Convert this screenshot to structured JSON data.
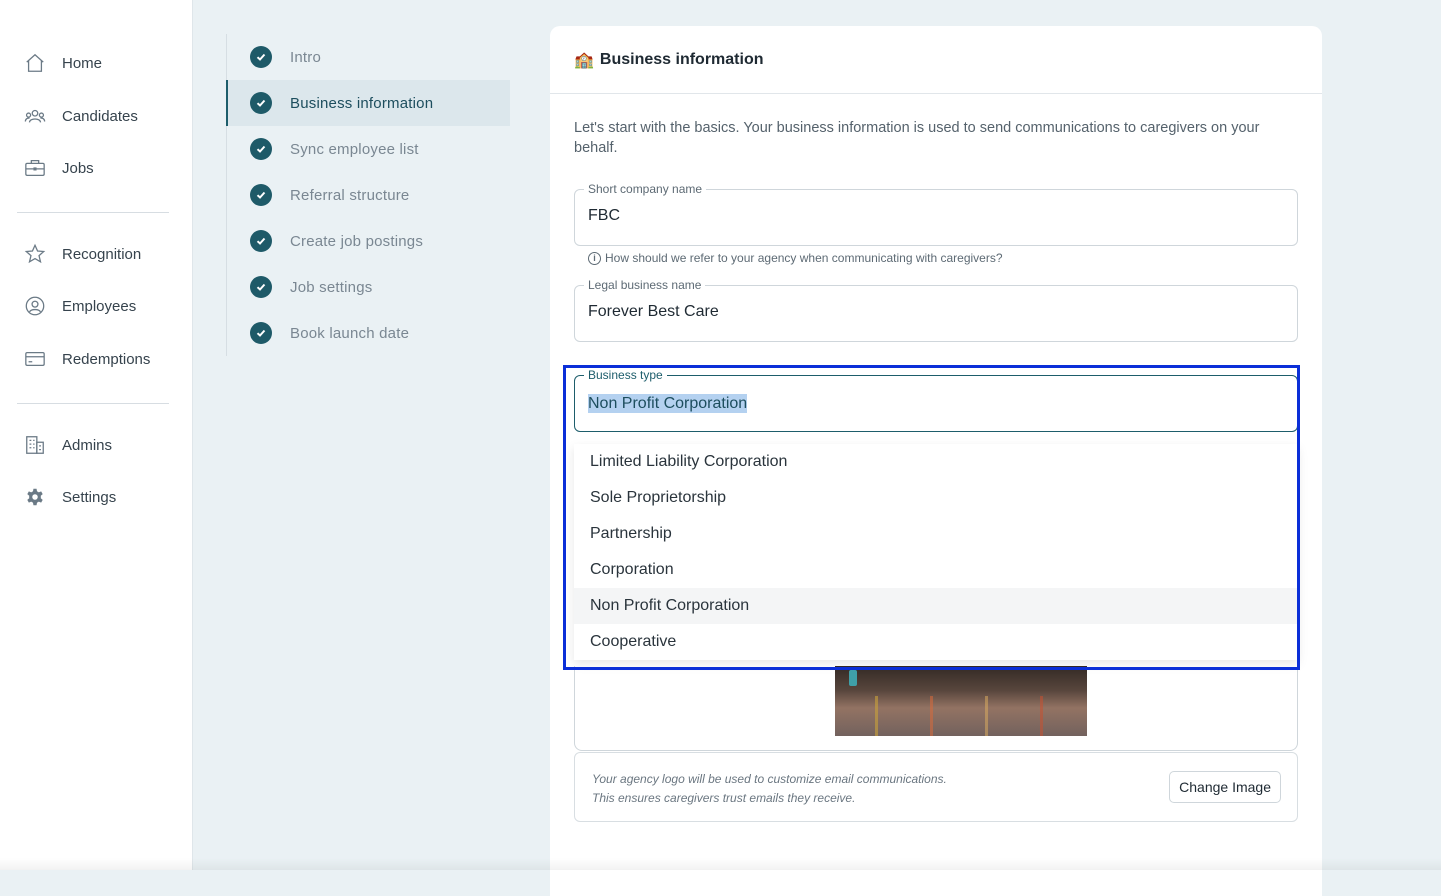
{
  "sidebar": {
    "items": [
      {
        "label": "Home",
        "icon": "home-icon"
      },
      {
        "label": "Candidates",
        "icon": "users-icon"
      },
      {
        "label": "Jobs",
        "icon": "briefcase-icon"
      },
      {
        "label": "Recognition",
        "icon": "star-icon"
      },
      {
        "label": "Employees",
        "icon": "user-circle-icon"
      },
      {
        "label": "Redemptions",
        "icon": "credit-card-icon"
      },
      {
        "label": "Admins",
        "icon": "building-icon"
      },
      {
        "label": "Settings",
        "icon": "gear-icon"
      }
    ]
  },
  "steps": [
    {
      "label": "Intro",
      "done": true
    },
    {
      "label": "Business information",
      "done": true,
      "active": true
    },
    {
      "label": "Sync employee list",
      "done": true
    },
    {
      "label": "Referral structure",
      "done": true
    },
    {
      "label": "Create job postings",
      "done": true
    },
    {
      "label": "Job settings",
      "done": true
    },
    {
      "label": "Book launch date",
      "done": true
    }
  ],
  "card": {
    "emoji": "🏫",
    "title": "Business information",
    "intro": "Let's start with the basics. Your business information is used to send communications to caregivers on your behalf."
  },
  "form": {
    "short_name": {
      "label": "Short company name",
      "value": "FBC",
      "hint": "How should we refer to your agency when communicating with caregivers?"
    },
    "legal_name": {
      "label": "Legal business name",
      "value": "Forever Best Care"
    },
    "business_type": {
      "label": "Business type",
      "value": "Non Profit Corporation",
      "options": [
        "Limited Liability Corporation",
        "Sole Proprietorship",
        "Partnership",
        "Corporation",
        "Non Profit Corporation",
        "Cooperative"
      ]
    },
    "logo": {
      "note_line1": "Your agency logo will be used to customize email communications.",
      "note_line2": "This ensures caregivers trust emails they receive.",
      "button": "Change Image"
    }
  },
  "colors": {
    "accent": "#1e5a68",
    "highlight_box": "#0b2fd8"
  }
}
